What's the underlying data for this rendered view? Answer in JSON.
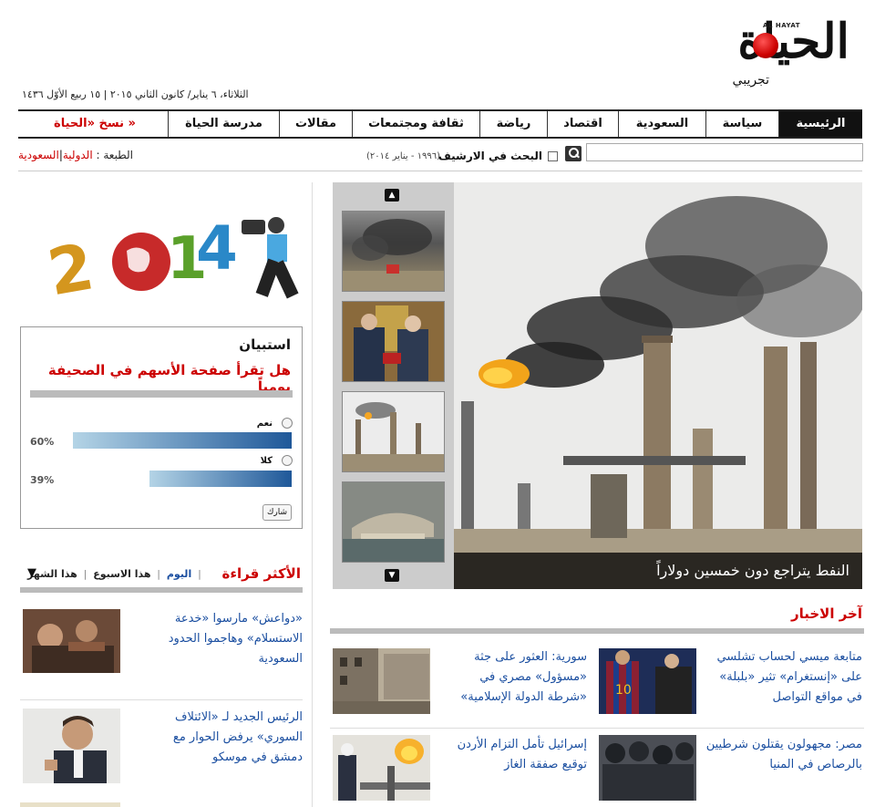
{
  "header": {
    "logo_text": "الحياة",
    "logo_en": "AL HAYAT",
    "logo_sub": "تجريبي",
    "date": "الثلاثاء، ٦ يناير/ كانون الثاني ٢٠١٥ | ١٥ ربيع الأوّل ١٤٣٦"
  },
  "nav": {
    "items": [
      {
        "label": "الرئيسية",
        "active": true
      },
      {
        "label": "سياسة"
      },
      {
        "label": "السعودية"
      },
      {
        "label": "اقتصاد"
      },
      {
        "label": "رياضة"
      },
      {
        "label": "ثقافة ومجتمعات"
      },
      {
        "label": "مقالات"
      },
      {
        "label": "مدرسة الحياة"
      },
      {
        "label": "نسخ «الحياة »",
        "red": true
      }
    ]
  },
  "search": {
    "placeholder": "",
    "archive_label": "البحث في الارشيف",
    "archive_range": "(١٩٩٦ - يناير ٢٠١٤)"
  },
  "edition": {
    "label": "الطبعة :",
    "intl": "الدولية",
    "sep": "|",
    "saudi": "السعودية"
  },
  "slider": {
    "up_icon": "chevron-up-icon",
    "down_icon": "chevron-down-icon",
    "hero_caption": "النفط يتراجع دون خمسين دولاراً"
  },
  "latest": {
    "title": "آخر الاخبار",
    "items": [
      {
        "text": "متابعة ميسي لحساب تشلسي على «إنستغرام» تثير «بلبلة» في مواقع التواصل"
      },
      {
        "text": "سورية: العثور على جثة «مسؤول» مصري في «شرطة الدولة الإسلامية»"
      },
      {
        "text": "مصر: مجهولون يقتلون شرطيين بالرصاص في المنيا"
      },
      {
        "text": "إسرائيل تأمل التزام الأردن توقيع صفقة الغاز"
      }
    ]
  },
  "poll": {
    "title": "استبيان",
    "question": "هل تقرأ صفحة الأسهم في الصحيفة يومياً",
    "options": [
      {
        "label": "نعم",
        "percent": 60,
        "percent_text": "60%"
      },
      {
        "label": "كلا",
        "percent": 39,
        "percent_text": "39%"
      }
    ],
    "share_label": "شارك"
  },
  "most_read": {
    "title": "الأكثر قراءة",
    "tabs": [
      "اليوم",
      "هذا الاسبوع",
      "هذا الشهر"
    ],
    "arrow": "▼",
    "items": [
      {
        "text": "«دواعش» مارسوا «خدعة الاستسلام» وهاجموا الحدود السعودية"
      },
      {
        "text": "الرئيس الجديد لـ «الائتلاف السوري» يرفض الحوار مع دمشق في موسكو"
      }
    ]
  }
}
